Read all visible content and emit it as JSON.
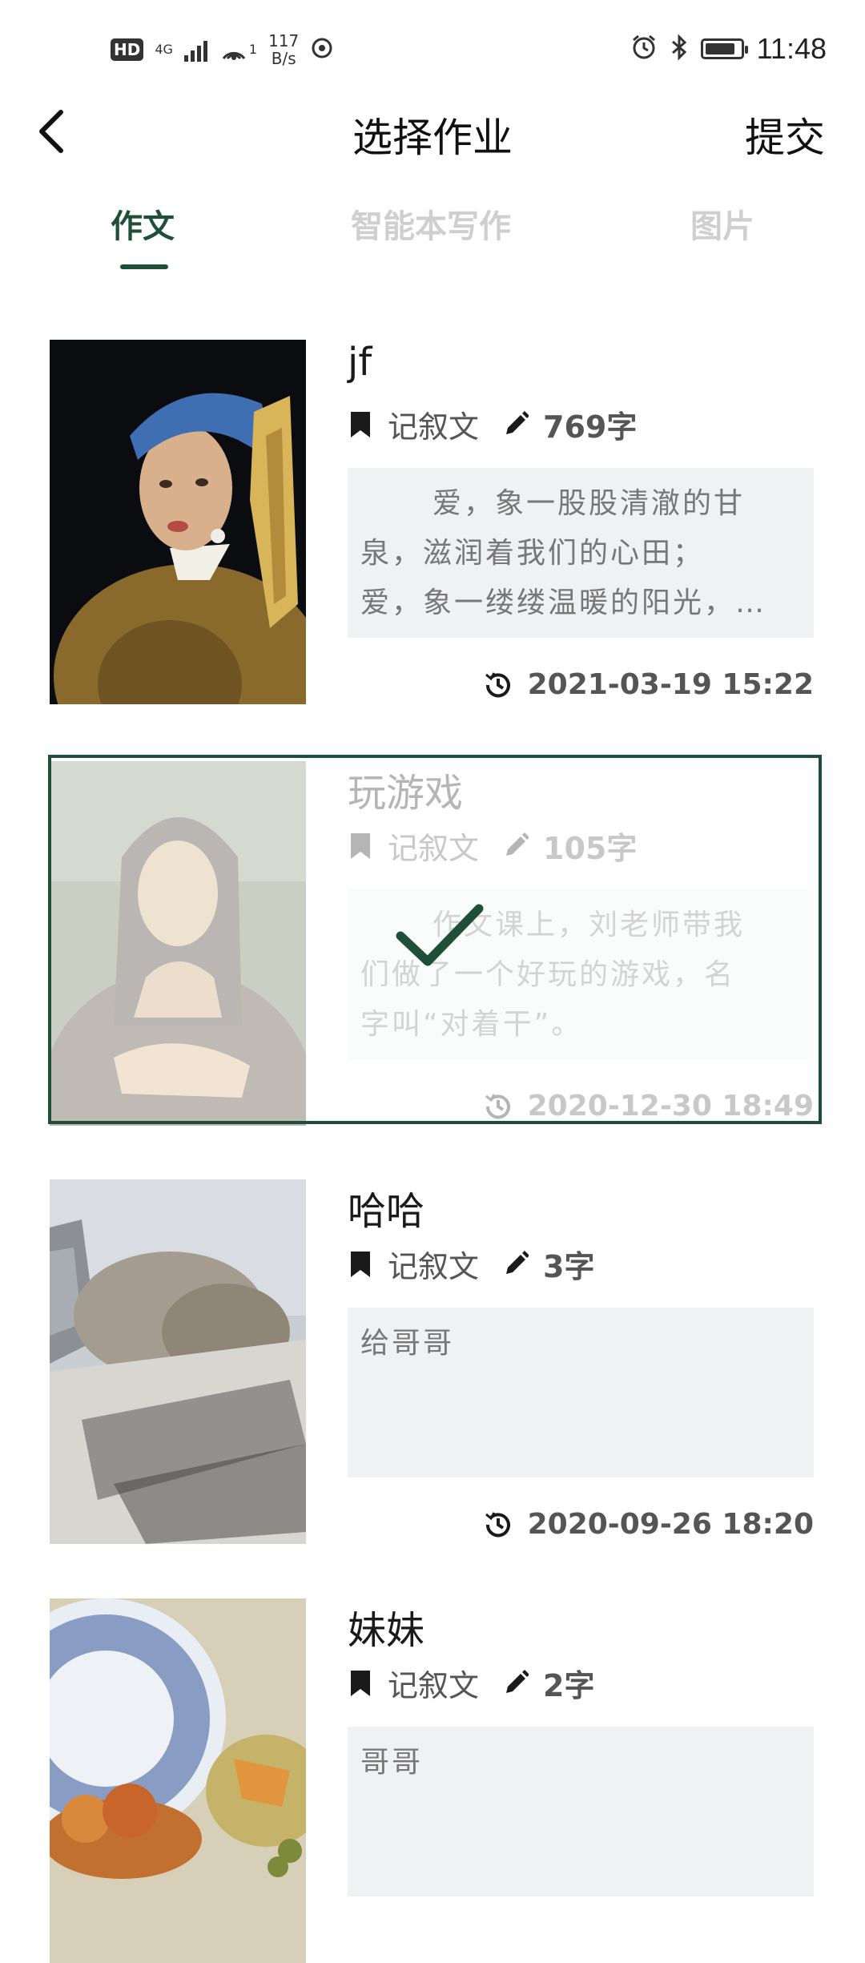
{
  "status_bar": {
    "hd": "HD",
    "network": "4G",
    "hotspot_count": "1",
    "speed_value": "117",
    "speed_unit": "B/s",
    "time": "11:48",
    "icons": [
      "signal-icon",
      "hotspot-icon",
      "sync-icon",
      "alarm-icon",
      "bluetooth-icon",
      "battery-icon"
    ]
  },
  "header": {
    "back_icon": "chevron-left-icon",
    "title": "选择作业",
    "submit_label": "提交"
  },
  "tabs": [
    {
      "label": "作文",
      "active": true
    },
    {
      "label": "智能本写作",
      "active": false
    },
    {
      "label": "图片",
      "active": false
    }
  ],
  "colors": {
    "accent": "#1f4f3a",
    "excerpt_bg": "#f0f1f3",
    "inactive_tab": "#cfcfcf"
  },
  "essays": [
    {
      "title": "jf",
      "genre": "记叙文",
      "word_count": "769字",
      "excerpt": [
        "爱，象一股股清澈的甘",
        "泉，滋润着我们的心田；",
        "爱，象一缕缕温暖的阳光，…"
      ],
      "date": "2021-03-19 15:22",
      "selected": false
    },
    {
      "title": "玩游戏",
      "genre": "记叙文",
      "word_count": "105字",
      "excerpt": [
        "作文课上，刘老师带我",
        "们做了一个好玩的游戏，名",
        "字叫“对着干”。"
      ],
      "date": "2020-12-30 18:49",
      "selected": true
    },
    {
      "title": "哈哈",
      "genre": "记叙文",
      "word_count": "3字",
      "excerpt": [
        "给哥哥"
      ],
      "date": "2020-09-26 18:20",
      "selected": false
    },
    {
      "title": "妹妹",
      "genre": "记叙文",
      "word_count": "2字",
      "excerpt": [
        "哥哥"
      ],
      "date": "",
      "selected": false
    }
  ]
}
